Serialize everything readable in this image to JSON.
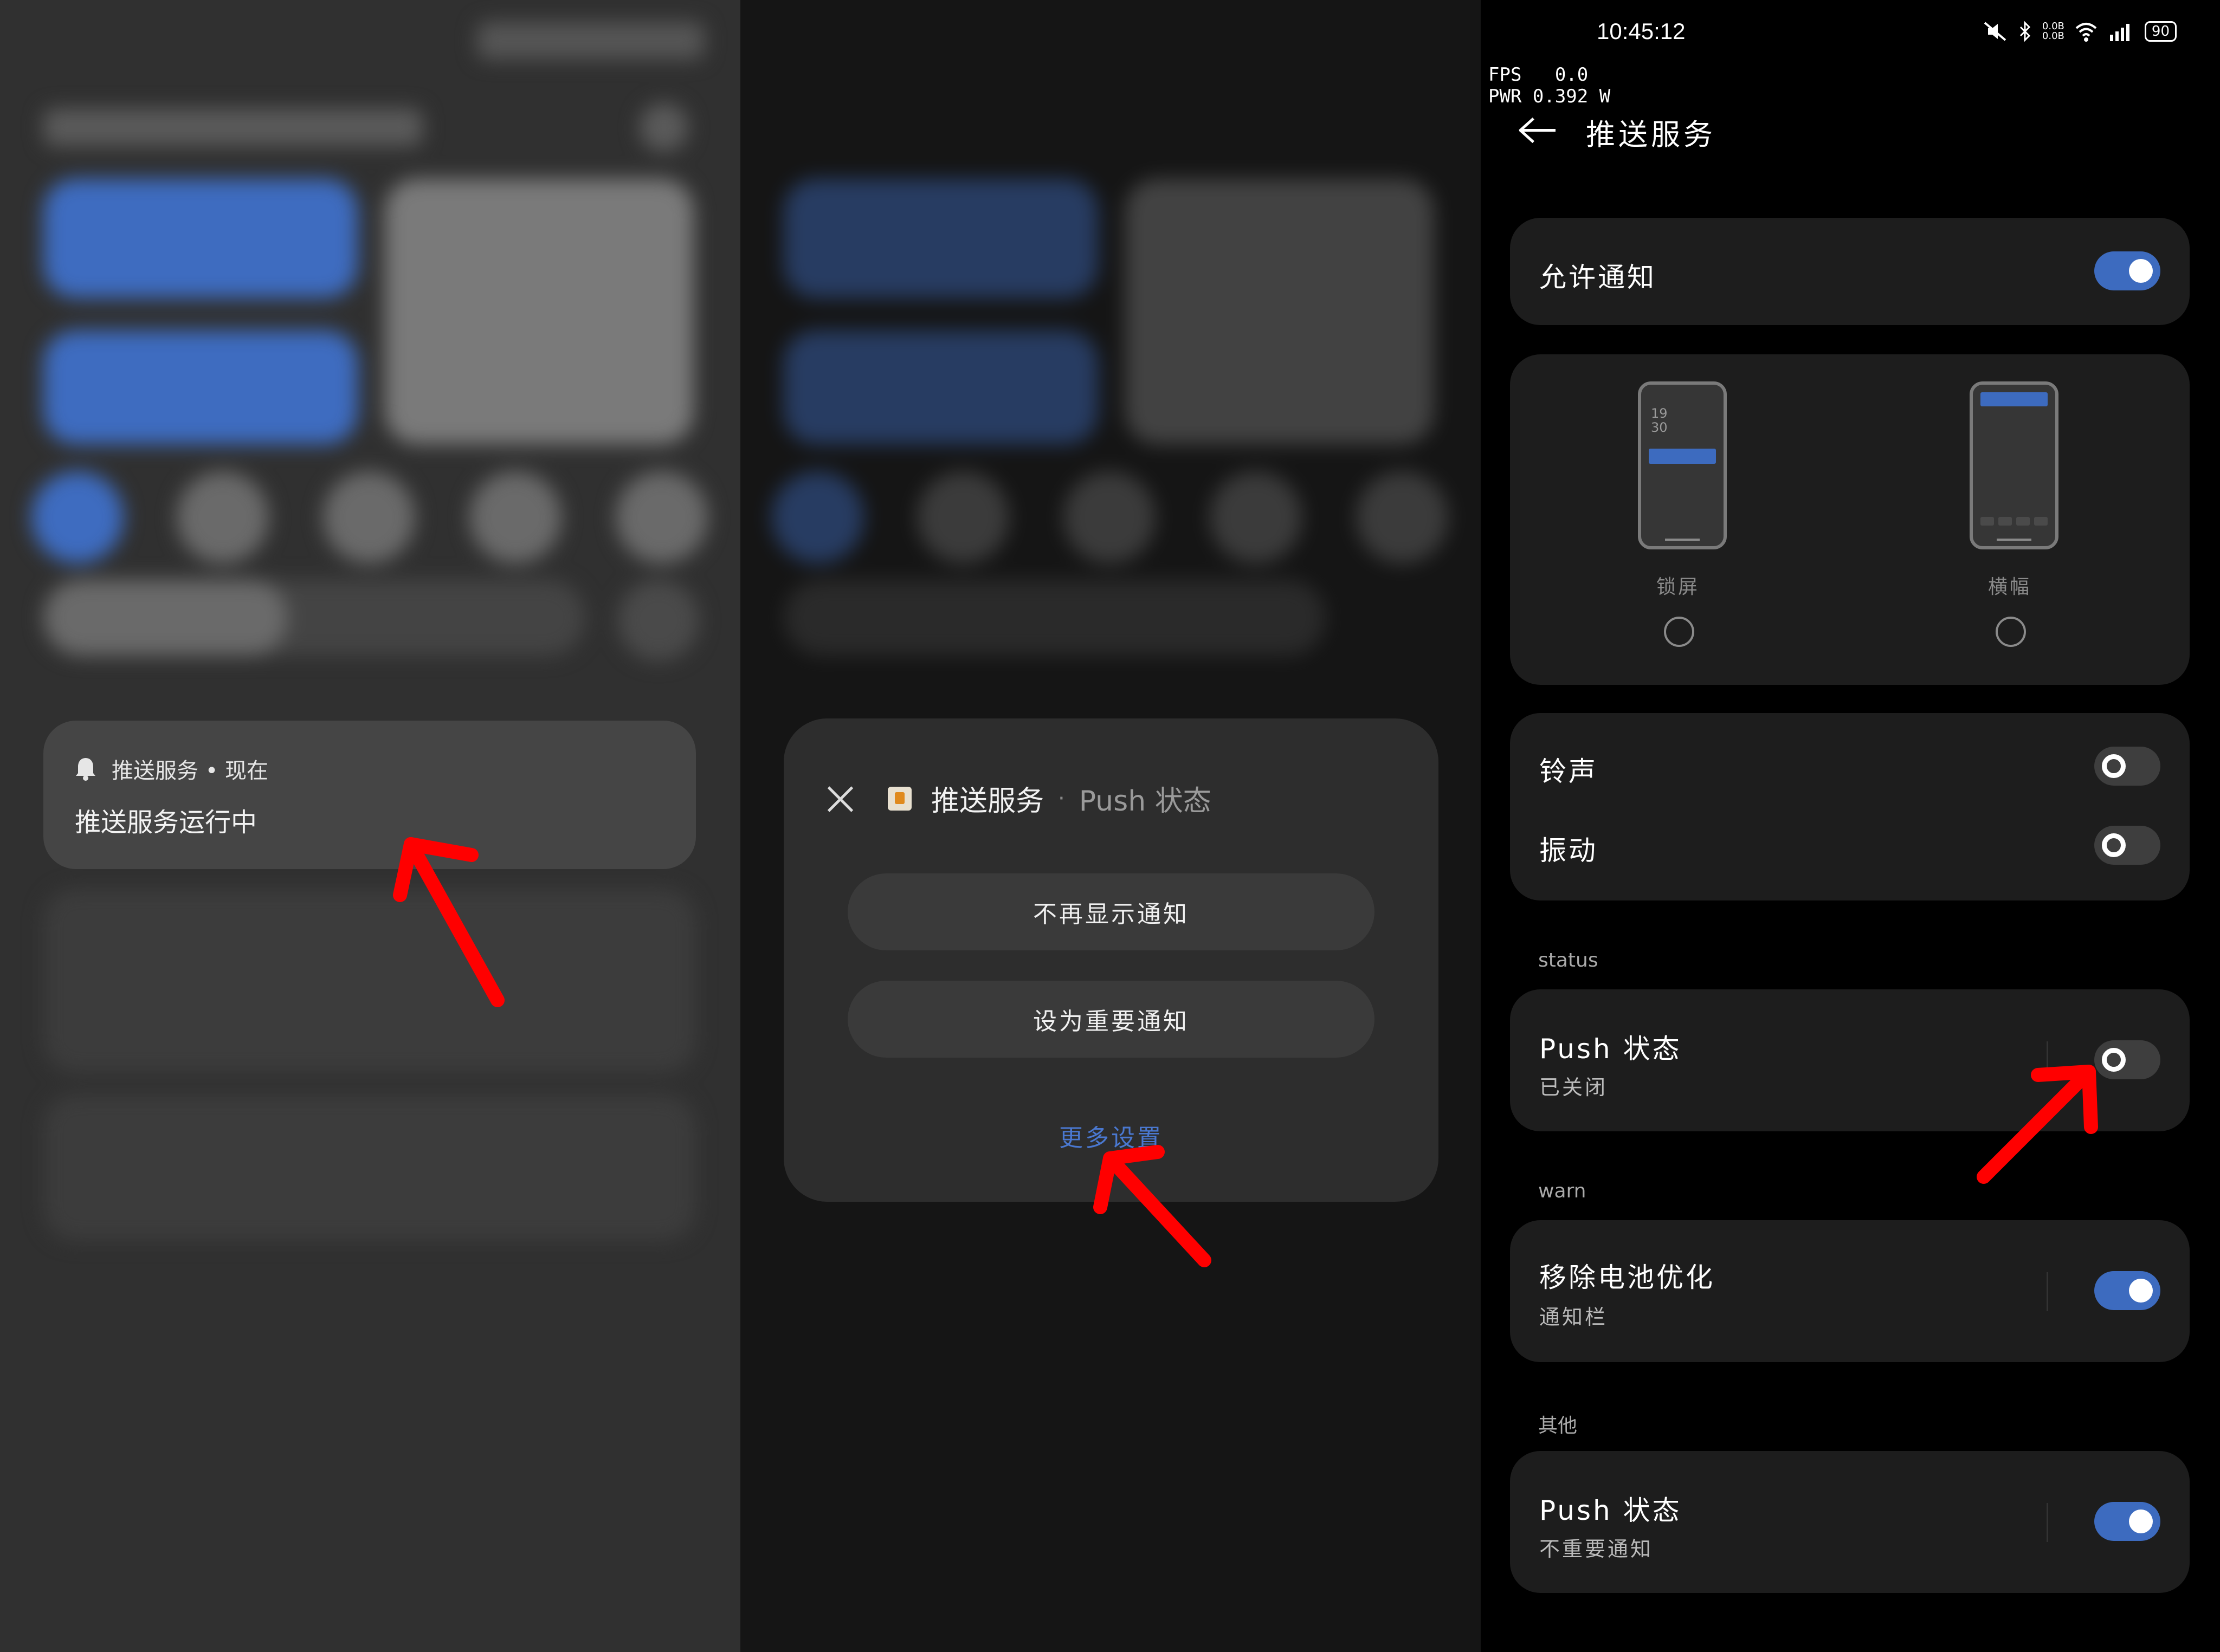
{
  "panel1": {
    "notification": {
      "header": "推送服务 • 现在",
      "body": "推送服务运行中"
    }
  },
  "panel2": {
    "dialog": {
      "app_name": "推送服务",
      "separator": "·",
      "channel": "Push 状态",
      "buttons": [
        "不再显示通知",
        "设为重要通知"
      ],
      "more_link": "更多设置"
    }
  },
  "panel3": {
    "status_bar": {
      "time": "10:45:12",
      "icons": [
        "mute-icon",
        "bluetooth-icon",
        "data-speed-icon",
        "wifi-icon",
        "signal-5g-icon"
      ],
      "data_speed": "0.0B\n0.0B",
      "battery": "90"
    },
    "overlay": {
      "fps": "FPS   0.0",
      "pwr": "PWR 0.392 W"
    },
    "title": "推送服务",
    "allow_notifications": {
      "label": "允许通知",
      "on": true
    },
    "styles": [
      {
        "label": "锁屏",
        "clock": "19\n30",
        "selected": false
      },
      {
        "label": "横幅",
        "selected": false
      }
    ],
    "sound": {
      "label": "铃声",
      "on": false
    },
    "vibrate": {
      "label": "振动",
      "on": false
    },
    "sections": [
      {
        "header": "status",
        "title": "Push 状态",
        "subtitle": "已关闭",
        "on": false
      },
      {
        "header": "warn",
        "title": "移除电池优化",
        "subtitle": "通知栏",
        "on": true
      },
      {
        "header": "其他",
        "title": "Push 状态",
        "subtitle": "不重要通知",
        "on": true
      }
    ]
  },
  "colors": {
    "accent": "#3d6bbf",
    "arrow": "#ff0000",
    "link": "#4a78d0"
  }
}
